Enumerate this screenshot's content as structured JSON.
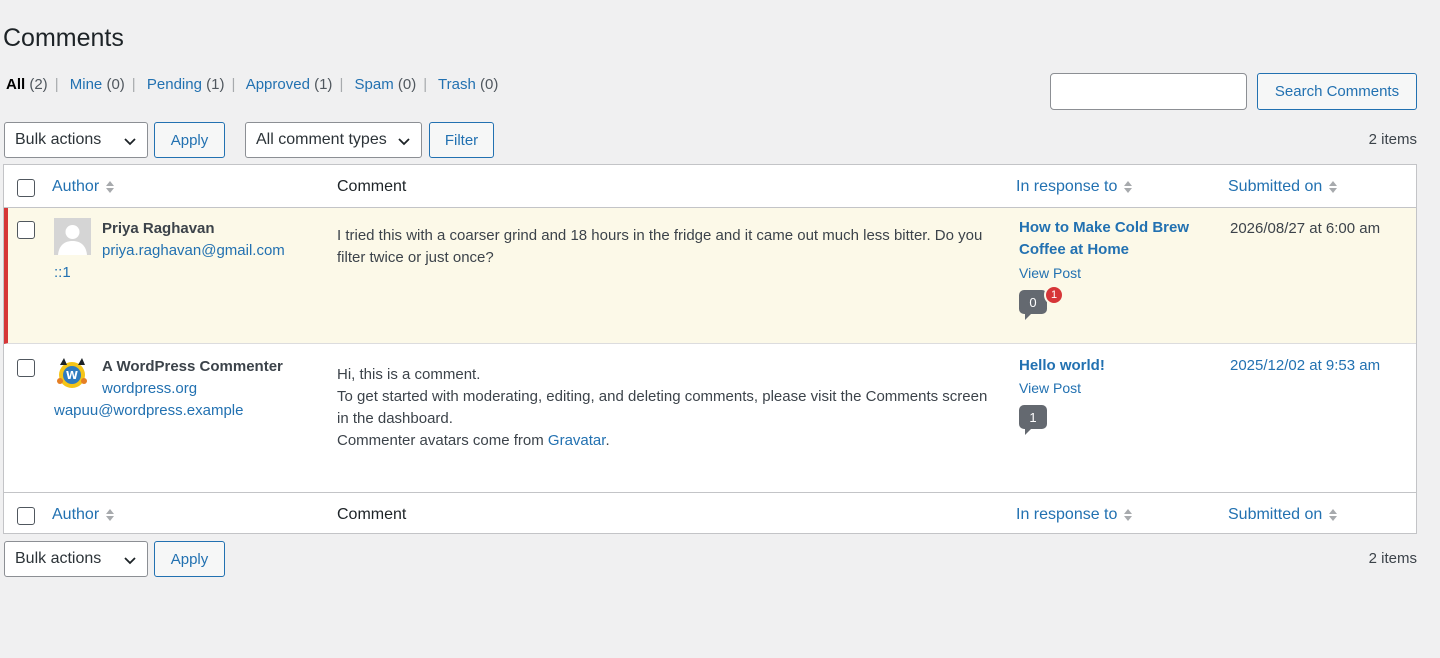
{
  "page_title": "Comments",
  "filters": [
    {
      "label": "All",
      "count": "(2)",
      "current": true
    },
    {
      "label": "Mine",
      "count": "(0)"
    },
    {
      "label": "Pending",
      "count": "(1)"
    },
    {
      "label": "Approved",
      "count": "(1)"
    },
    {
      "label": "Spam",
      "count": "(0)"
    },
    {
      "label": "Trash",
      "count": "(0)"
    }
  ],
  "search": {
    "value": "",
    "button_label": "Search Comments"
  },
  "toolbar_top": {
    "bulk_actions": "Bulk actions",
    "apply_label": "Apply",
    "comment_types": "All comment types",
    "filter_label": "Filter",
    "items_count": "2 items"
  },
  "columns": {
    "author": "Author",
    "comment": "Comment",
    "in_response_to": "In response to",
    "submitted_on": "Submitted on"
  },
  "comments": [
    {
      "author_name": "Priya Raghavan",
      "author_email": "priya.raghavan@gmail.com",
      "author_ip": "::1",
      "text": "I tried this with a coarser grind and 18 hours in the fridge and it came out much less bitter. Do you filter twice or just once?",
      "post_title": "How to Make Cold Brew Coffee at Home",
      "view_post": "View Post",
      "approved_count": "0",
      "pending_count": "1",
      "submitted": "2026/08/27 at 6:00 am",
      "status": "unapproved"
    },
    {
      "author_name": "A WordPress Commenter",
      "author_url": "wordpress.org",
      "author_email": "wapuu@wordpress.example",
      "text_line1": "Hi, this is a comment.",
      "text_line2": "To get started with moderating, editing, and deleting comments, please visit the Comments screen in the dashboard.",
      "text_line3_prefix": "Commenter avatars come from ",
      "text_line3_link": "Gravatar",
      "text_line3_suffix": ".",
      "post_title": "Hello world!",
      "view_post": "View Post",
      "approved_count": "1",
      "submitted": "2025/12/02 at 9:53 am",
      "status": "approved"
    }
  ],
  "toolbar_bottom": {
    "bulk_actions": "Bulk actions",
    "apply_label": "Apply",
    "items_count": "2 items"
  },
  "colors": {
    "accent": "#2271b1",
    "unapproved_bg": "#fcf9e8",
    "unapproved_border": "#d63638",
    "bubble": "#646970"
  }
}
